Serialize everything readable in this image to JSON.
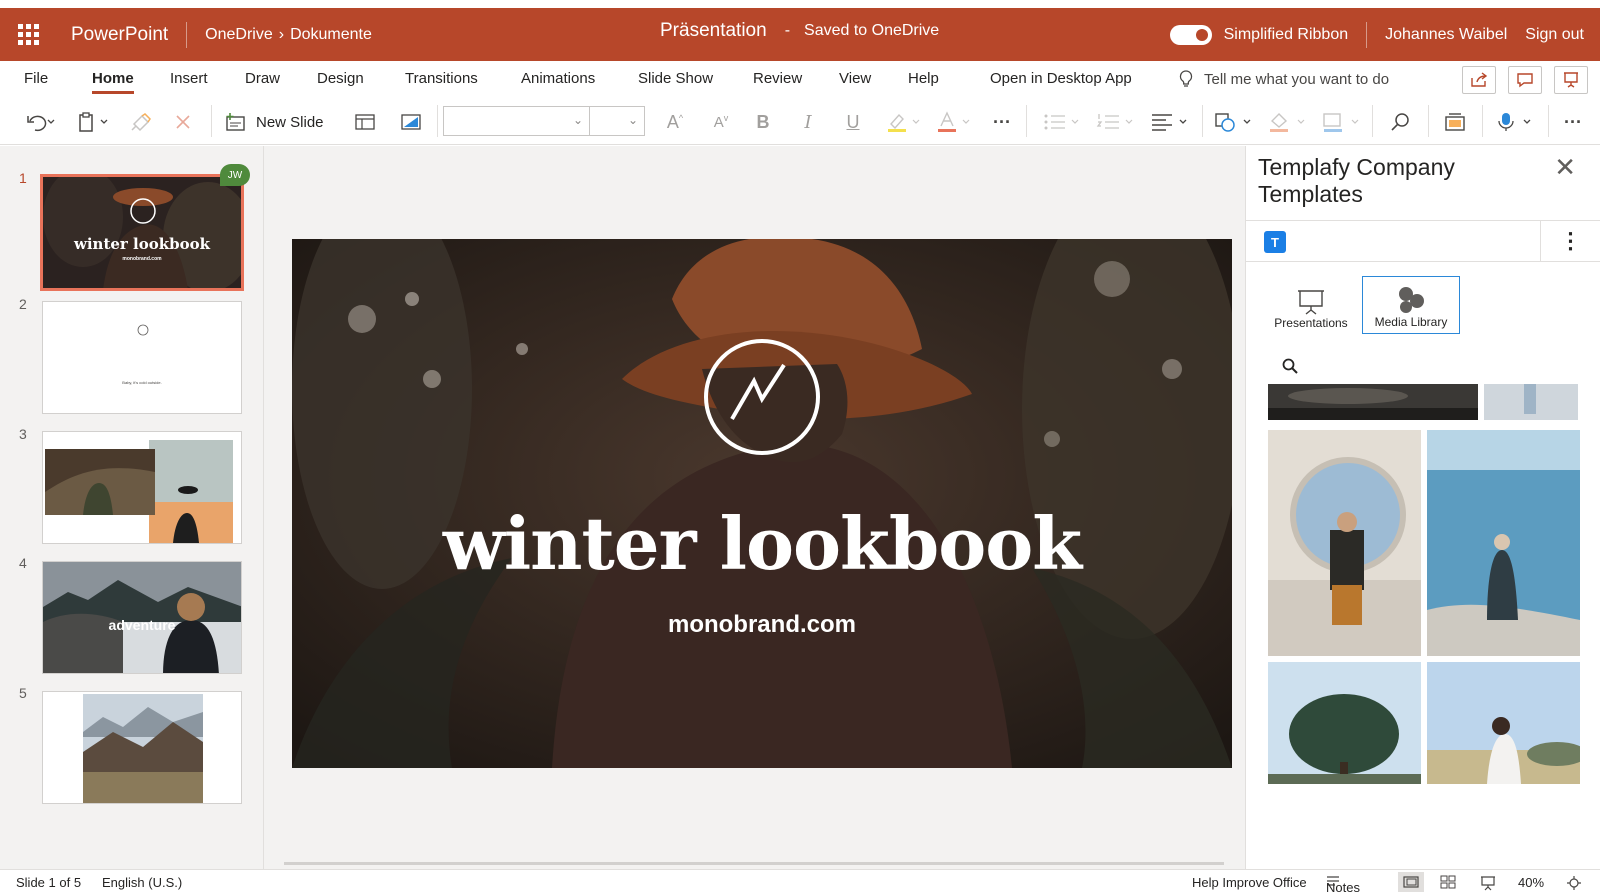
{
  "titlebar": {
    "app_name": "PowerPoint",
    "breadcrumb_root": "OneDrive",
    "breadcrumb_folder": "Dokumente",
    "doc_title": "Präsentation",
    "separator": "-",
    "save_status": "Saved to OneDrive",
    "simplified_ribbon": "Simplified Ribbon",
    "user_name": "Johannes Waibel",
    "sign_out": "Sign out"
  },
  "menu": {
    "tabs": [
      "File",
      "Home",
      "Insert",
      "Draw",
      "Design",
      "Transitions",
      "Animations",
      "Slide Show",
      "Review",
      "View",
      "Help"
    ],
    "active_tab": "Home",
    "open_desktop": "Open in Desktop App",
    "tell_me": "Tell me what you want to do"
  },
  "ribbon": {
    "new_slide": "New Slide",
    "font_name": "",
    "font_size": ""
  },
  "thumbnails": {
    "numbers": [
      "1",
      "2",
      "3",
      "4",
      "5"
    ],
    "slide1_title": "winter lookbook",
    "slide1_sub": "monobrand.com",
    "slide2_text": "Baby, it's cold outside.",
    "slide4_text": "adventure",
    "presence_initials": "JW"
  },
  "slide": {
    "title": "winter lookbook",
    "subtitle": "monobrand.com"
  },
  "panel": {
    "title": "Templafy Company Templates",
    "logo_letter": "T",
    "tab_presentations": "Presentations",
    "tab_media": "Media Library",
    "active_tab": "Media Library"
  },
  "status": {
    "slide_counter": "Slide 1 of 5",
    "language": "English (U.S.)",
    "help_improve": "Help Improve Office",
    "notes": "Notes",
    "zoom": "40%"
  },
  "colors": {
    "brand": "#b7472a",
    "active_thumb_border": "#e8735a",
    "presence": "#4f8a3c",
    "templafy_blue": "#1b7fe5"
  }
}
